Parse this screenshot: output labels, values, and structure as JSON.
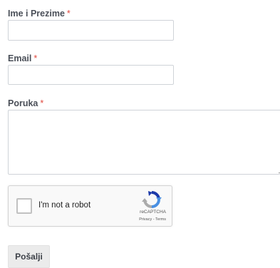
{
  "form": {
    "required_marker": "*",
    "fields": {
      "name": {
        "label": "Ime i Prezime",
        "value": ""
      },
      "email": {
        "label": "Email",
        "value": ""
      },
      "message": {
        "label": "Poruka",
        "value": ""
      }
    },
    "recaptcha": {
      "checkbox_label": "I'm not a robot",
      "brand": "reCAPTCHA",
      "terms": "Privacy - Terms",
      "checked": false
    },
    "submit_label": "Pošalji"
  },
  "colors": {
    "required": "#e0483e",
    "label": "#4a4f58",
    "input_border": "#cfd3d8",
    "button_bg": "#ebebeb"
  }
}
